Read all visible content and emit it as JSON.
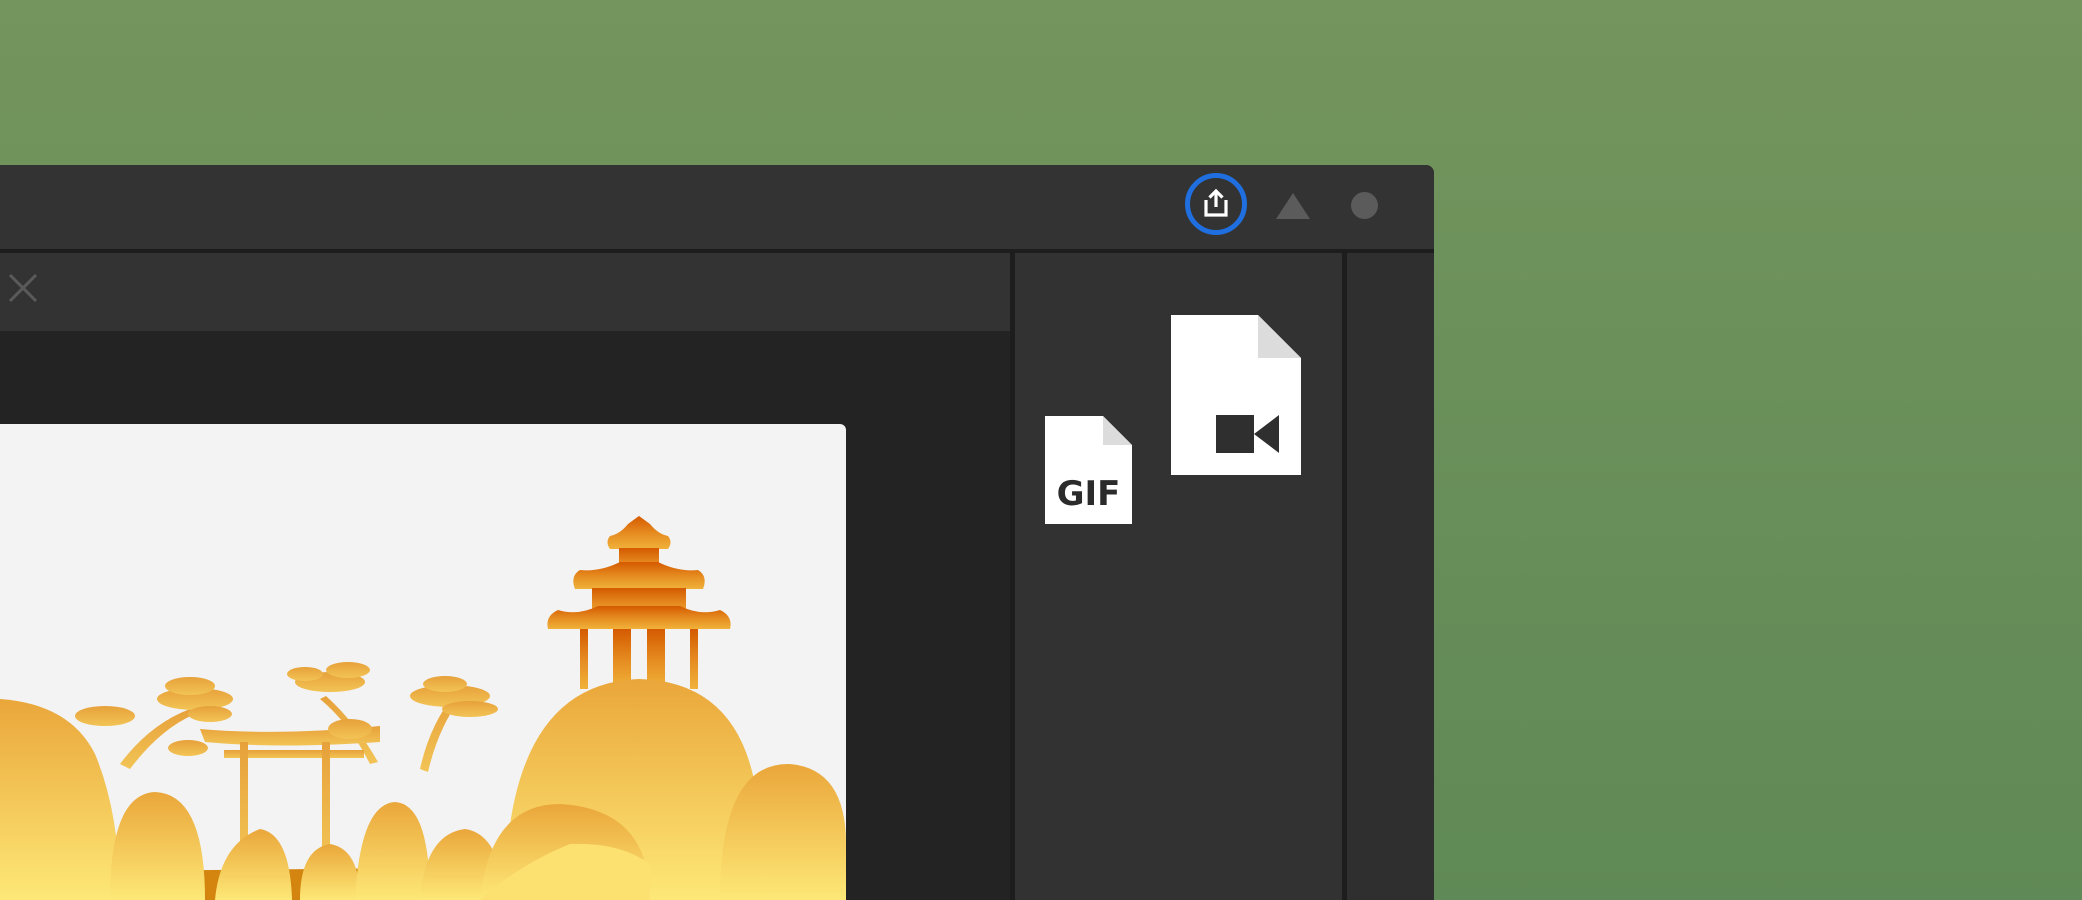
{
  "toolbar": {
    "share_icon": "share-export-icon",
    "triangle_icon": "triangle-icon",
    "circle_icon": "circle-icon",
    "highlight_color": "#1f6fe0"
  },
  "tab": {
    "close_icon": "close-icon"
  },
  "export_panel": {
    "gif_label": "GIF",
    "gif_icon": "gif-file-icon",
    "video_icon": "video-file-icon"
  },
  "colors": {
    "background_top": "#74955d",
    "background_bottom": "#5f8956",
    "titlebar": "#333333",
    "panel": "#323232",
    "canvas": "#232323"
  }
}
